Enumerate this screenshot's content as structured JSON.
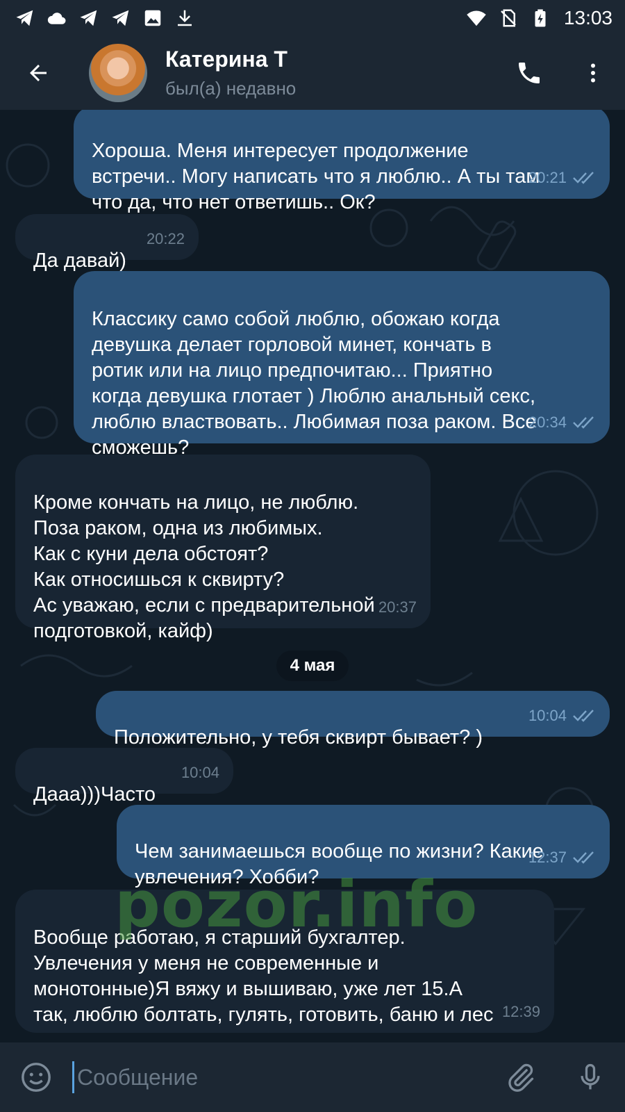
{
  "status_bar": {
    "time": "13:03",
    "left_icons": [
      "telegram-icon",
      "cloud-icon",
      "telegram-icon",
      "telegram-icon",
      "image-icon",
      "download-icon"
    ],
    "right_icons": [
      "wifi-icon",
      "no-sim-icon",
      "battery-icon"
    ]
  },
  "header": {
    "name": "Катерина Т",
    "status": "был(а) недавно"
  },
  "messages": [
    {
      "dir": "out",
      "text": "Хороша. Меня интересует продолжение\nвстречи.. Могу написать что я люблю.. А ты там\nчто да, что нет ответишь.. Ок?",
      "time": "20:21",
      "read": true
    },
    {
      "dir": "in",
      "text": "Да давай)",
      "time": "20:22"
    },
    {
      "dir": "out",
      "text": "Классику само собой люблю, обожаю когда\nдевушка делает горловой минет, кончать в\nротик или на лицо предпочитаю... Приятно\nкогда девушка глотает ) Люблю анальный секс,\nлюблю властвовать.. Любимая поза раком. Все\nсможешь?",
      "time": "20:34",
      "read": true
    },
    {
      "dir": "in",
      "text": "Кроме кончать на лицо, не люблю.\nПоза раком, одна из любимых.\nКак с куни дела обстоят?\nКак относишься к сквирту?\nАс уважаю, если с предварительной\nподготовкой, кайф)",
      "time": "20:37"
    },
    {
      "dir": "out",
      "text": "Положительно, у тебя сквирт бывает? )",
      "time": "10:04",
      "read": true
    },
    {
      "dir": "in",
      "text": "Дааа)))Часто",
      "time": "10:04"
    },
    {
      "dir": "out",
      "text": "Чем занимаешься вообще по жизни? Какие\nувлечения? Хобби?",
      "time": "12:37",
      "read": true
    },
    {
      "dir": "in",
      "text": "Вообще работаю, я старший бухгалтер.\nУвлечения у меня не современные и\nмонотонные)Я вяжу и вышиваю, уже лет 15.А\nтак, люблю болтать, гулять, готовить, баню и лес",
      "time": "12:39"
    }
  ],
  "date_separator": "4 мая",
  "watermark": "pozor.info",
  "input": {
    "placeholder": "Сообщение",
    "value": ""
  },
  "colors": {
    "header_bg": "#1c2733",
    "chat_bg": "#0f1a24",
    "outgoing_bubble": "#2b5278",
    "incoming_bubble": "#182533",
    "read_check": "#7da5c9",
    "cursor_accent": "#5aa3e0"
  }
}
